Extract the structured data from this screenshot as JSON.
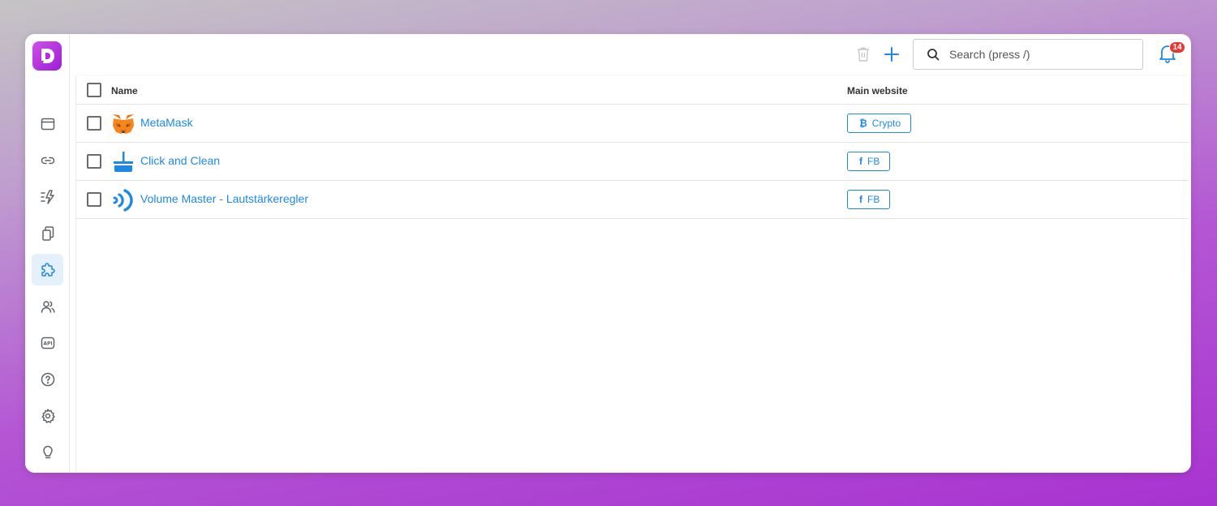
{
  "app": {
    "logo_letter": "D",
    "brand_color": "#b02ee0",
    "accent": "#1e88e5"
  },
  "sidebar": {
    "items": [
      {
        "name": "browser-icon",
        "active": false
      },
      {
        "name": "link-icon",
        "active": false
      },
      {
        "name": "automation-icon",
        "active": false
      },
      {
        "name": "copy-icon",
        "active": false
      },
      {
        "name": "extension-puzzle-icon",
        "active": true
      },
      {
        "name": "users-icon",
        "active": false
      },
      {
        "name": "api-icon",
        "active": false,
        "label": "API"
      },
      {
        "name": "help-icon",
        "active": false
      },
      {
        "name": "settings-icon",
        "active": false
      },
      {
        "name": "lightbulb-icon",
        "active": false
      }
    ]
  },
  "toolbar": {
    "search_placeholder": "Search (press /)",
    "notifications_count": "14"
  },
  "table": {
    "columns": [
      "Name",
      "Main website"
    ],
    "rows": [
      {
        "name": "MetaMask",
        "icon": "metamask-fox-icon",
        "tag": "Crypto",
        "tag_icon": "₿"
      },
      {
        "name": "Click and Clean",
        "icon": "broom-icon",
        "tag": "FB",
        "tag_icon": "f"
      },
      {
        "name": "Volume Master - Lautstärkeregler",
        "icon": "volume-waves-icon",
        "tag": "FB",
        "tag_icon": "f"
      }
    ]
  }
}
